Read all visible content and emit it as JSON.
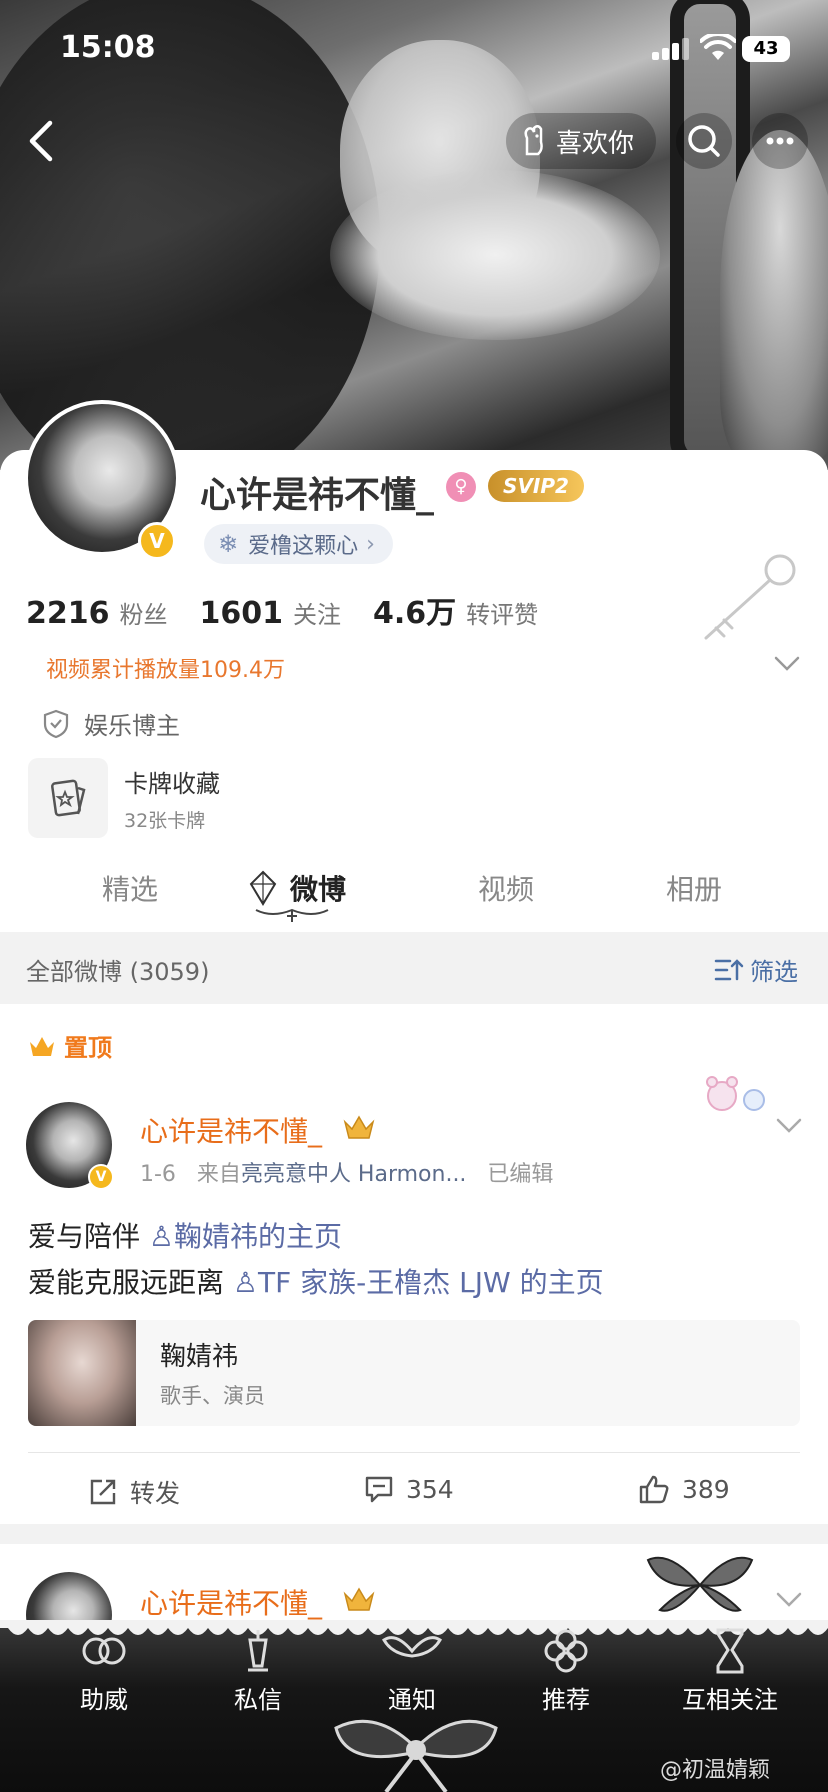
{
  "status_bar": {
    "time": "15:08",
    "battery": "43"
  },
  "header": {
    "like_label": "喜欢你"
  },
  "profile": {
    "name": "心许是祎不懂_",
    "vip_badge": "SVIP2",
    "fan_club": "爱橹这颗心",
    "stats": [
      {
        "num": "2216",
        "label": "粉丝"
      },
      {
        "num": "1601",
        "label": "关注"
      },
      {
        "num": "4.6万",
        "label": "转评赞"
      }
    ],
    "video_plays": "视频累计播放量109.4万",
    "cert": "娱乐博主",
    "cards_entry": {
      "title": "卡牌收藏",
      "sub": "32张卡牌"
    }
  },
  "tabs": [
    {
      "label": "精选"
    },
    {
      "label": "微博"
    },
    {
      "label": "视频"
    },
    {
      "label": "相册"
    }
  ],
  "filter_bar": {
    "all": "全部微博 (3059)",
    "filter": "筛选"
  },
  "post": {
    "pinned": "置顶",
    "author": "心许是祎不懂_",
    "meta_date": "1-6",
    "meta_from": "来自",
    "meta_source": "亮亮意中人 Harmon...",
    "meta_edited": "已编辑",
    "line1": "爱与陪伴",
    "mention1": "鞠婧祎的主页",
    "line2": "爱能克服远距离",
    "mention2": "TF 家族-王橹杰 LJW 的主页",
    "card_name": "鞠婧祎",
    "card_desc": "歌手、演员",
    "repost": "转发",
    "comments": "354",
    "likes": "389"
  },
  "post2": {
    "author": "心许是祎不懂_"
  },
  "bottom_bar": [
    {
      "label": "助威"
    },
    {
      "label": "私信"
    },
    {
      "label": "通知"
    },
    {
      "label": "推荐"
    },
    {
      "label": "互相关注"
    }
  ],
  "watermark": "@初温婧颖"
}
